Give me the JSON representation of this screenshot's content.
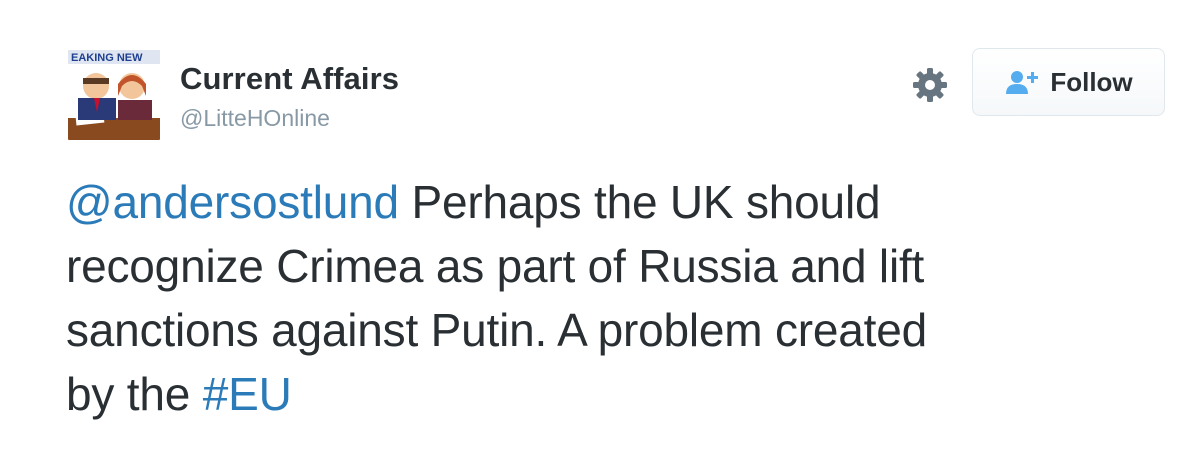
{
  "account": {
    "name": "Current Affairs",
    "handle": "@LitteHOnline",
    "avatar_banner_text": "EAKING NEW"
  },
  "actions": {
    "settings_icon": "gear-icon",
    "follow_icon": "add-user-icon",
    "follow_label": "Follow"
  },
  "tweet": {
    "mention": "@andersostlund",
    "line1_rest": " Perhaps the UK should",
    "line2": "recognize Crimea as part of Russia and lift",
    "line3": "sanctions against Putin. A problem created",
    "line4_prefix": "by the ",
    "hashtag": "#EU"
  },
  "colors": {
    "link": "#2b7bb9",
    "text": "#292f33",
    "muted": "#8899a6"
  }
}
